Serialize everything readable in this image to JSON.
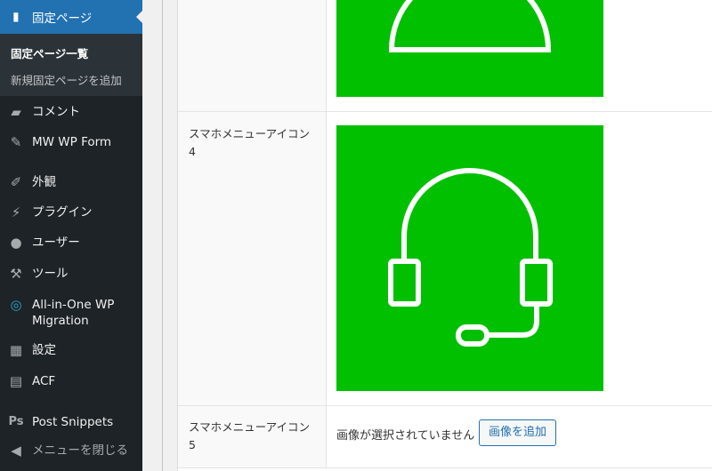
{
  "sidebar": {
    "active": {
      "label": "固定ページ",
      "icon": "pages-icon"
    },
    "submenu": [
      "固定ページ一覧",
      "新規固定ページを追加"
    ],
    "items": [
      {
        "label": "コメント",
        "icon": "comment-icon"
      },
      {
        "label": "MW WP Form",
        "icon": "pin-icon"
      },
      {
        "label": "外観",
        "icon": "brush-icon"
      },
      {
        "label": "プラグイン",
        "icon": "plugin-icon"
      },
      {
        "label": "ユーザー",
        "icon": "user-icon"
      },
      {
        "label": "ツール",
        "icon": "wrench-icon"
      },
      {
        "label": "All-in-One WP Migration",
        "icon": "migration-icon"
      },
      {
        "label": "設定",
        "icon": "settings-icon"
      },
      {
        "label": "ACF",
        "icon": "acf-icon"
      },
      {
        "label": "Post Snippets",
        "icon": "ps-icon"
      },
      {
        "label": "メニューを閉じる",
        "icon": "collapse-icon"
      }
    ],
    "ps_glyph": "Ps"
  },
  "fields": [
    {
      "label": "スマホメニューアイコン4",
      "image": "headset-icon"
    },
    {
      "label": "スマホメニューアイコン5",
      "empty_text": "画像が選択されていません",
      "button": "画像を追加"
    }
  ],
  "colors": {
    "accent": "#2271b1",
    "image_bg": "#00c000",
    "sidebar": "#1d2327"
  }
}
